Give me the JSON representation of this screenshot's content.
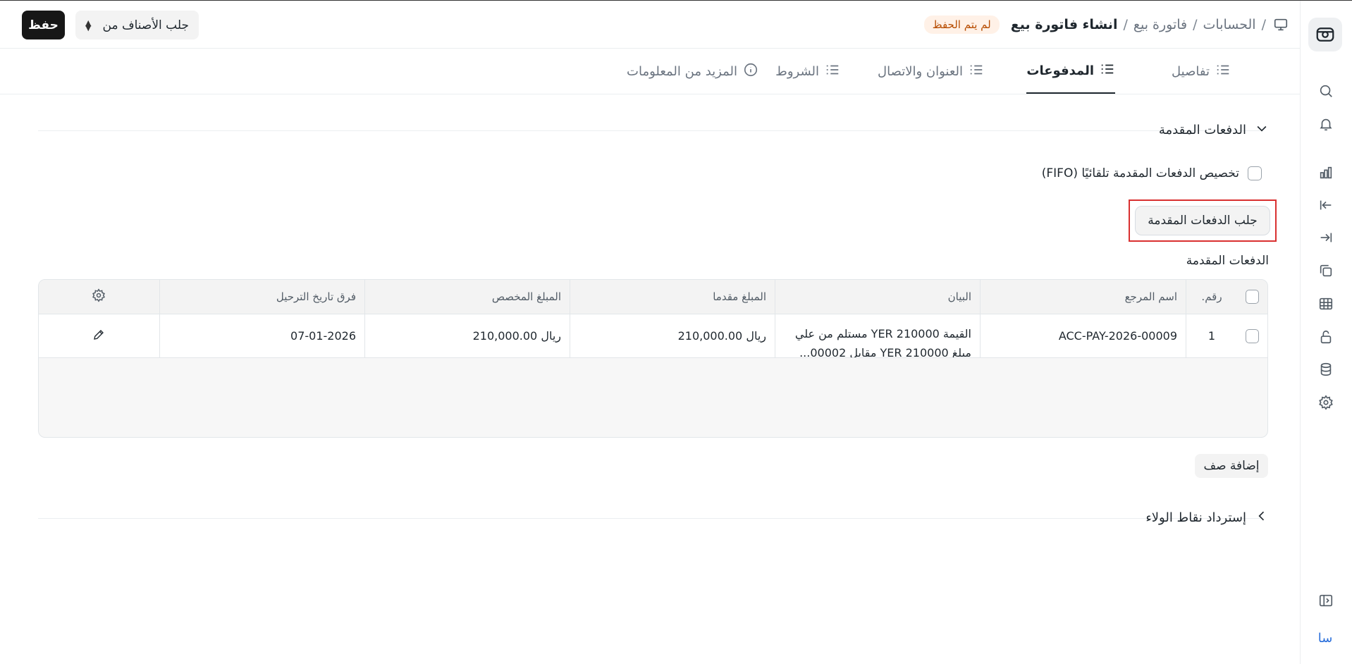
{
  "header": {
    "breadcrumb": [
      "الحسابات",
      "فاتورة بيع",
      "انشاء فاتورة بيع"
    ],
    "separator": "/",
    "status_badge": "لم يتم الحفظ",
    "save_label": "حفظ",
    "fetch_items_label": "جلب الأصناف من"
  },
  "tabs": [
    {
      "label": "تفاصيل",
      "icon": "list-icon"
    },
    {
      "label": "المدفوعات",
      "icon": "list-icon",
      "active": true
    },
    {
      "label": "العنوان والاتصال",
      "icon": "list-icon"
    },
    {
      "label": "الشروط",
      "icon": "list-icon"
    },
    {
      "label": "المزيد من المعلومات",
      "icon": "info-icon"
    }
  ],
  "advances": {
    "section_title": "الدفعات المقدمة",
    "auto_allocate_label": "تخصيص الدفعات المقدمة تلقائيًا (FIFO)",
    "fetch_button": "جلب الدفعات المقدمة",
    "table_label": "الدفعات المقدمة",
    "columns": [
      "رقم.",
      "اسم المرجع",
      "البيان",
      "المبلغ مقدما",
      "المبلغ المخصص",
      "فرق تاريخ الترحيل"
    ],
    "rows": [
      {
        "no": "1",
        "reference_name": "ACC-PAY-2026-00009",
        "remarks_line1": "القيمة YER 210000 مستلم من علي",
        "remarks_line2": "مبلغ YER 210000 مقابل 00002...",
        "advance_amount": "ريال 210,000.00",
        "allocated_amount": "ريال 210,000.00",
        "posting_date_diff": "07-01-2026"
      }
    ],
    "add_row": "إضافة صف"
  },
  "loyalty": {
    "section_title": "إسترداد نقاط الولاء"
  },
  "sidebar": {
    "user_initials": "سا",
    "icons": [
      "search-icon",
      "bell-icon",
      "chart-icon",
      "arrow-left-to-line-icon",
      "arrow-right-to-line-icon",
      "copy-icon",
      "table-icon",
      "lock-open-icon",
      "database-icon",
      "settings-icon",
      "sidebar-toggle-icon"
    ]
  },
  "colors": {
    "accent_dark": "#171717",
    "badge_bg": "#fff1e7",
    "badge_text": "#b74c00",
    "highlight": "#d93030",
    "user_text": "#2a6fdb"
  }
}
